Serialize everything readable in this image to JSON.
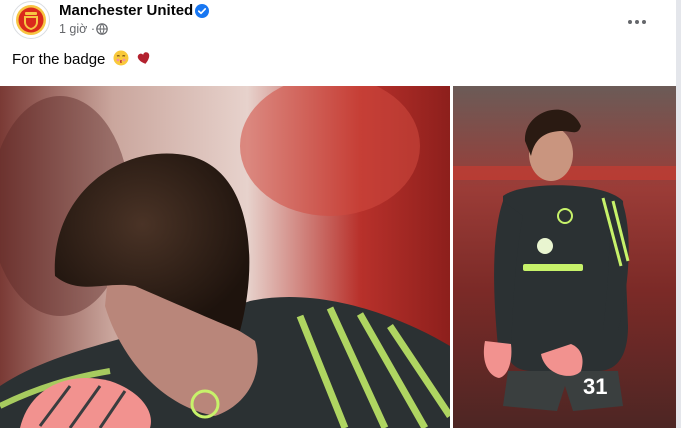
{
  "post": {
    "author": "Manchester United",
    "verified_icon": "verified-badge-icon",
    "timestamp": "1 giờ",
    "privacy_icon": "globe-icon",
    "more_icon": "more-options-icon",
    "caption": "For the badge"
  },
  "photos": {
    "right": {
      "shirt_number": "31"
    }
  },
  "colors": {
    "brand_red": "#da291c",
    "verified_blue": "#1877f2",
    "kit_dark": "#2b3133",
    "kit_accent": "#c7f26a"
  }
}
